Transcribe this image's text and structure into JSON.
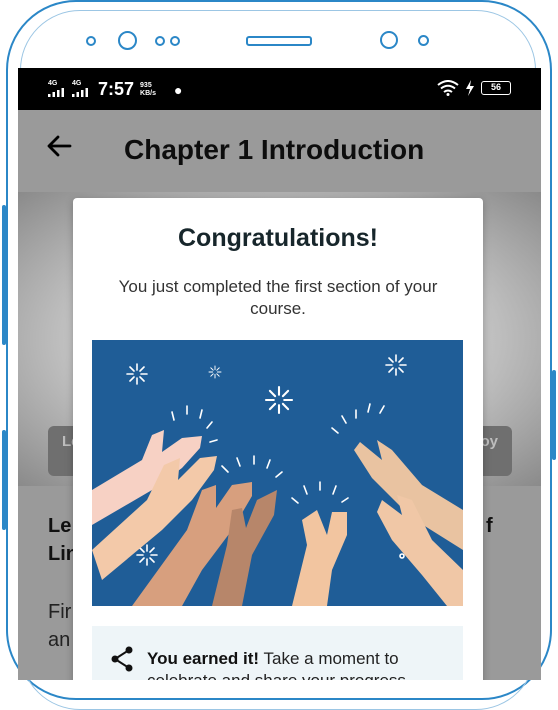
{
  "status_bar": {
    "signal_1": "4G",
    "signal_2": "4G",
    "time": "7:57",
    "speed_value": "935",
    "speed_unit": "KB/s",
    "battery": "56"
  },
  "app_bar": {
    "back_icon": "arrow-left",
    "title": "Chapter 1 Introduction"
  },
  "background": {
    "chip_left": "Le",
    "chip_right": "oy",
    "heading_line1": "Le",
    "heading_line2": "Lin",
    "heading_right": "f",
    "para_line1": "Fir",
    "para_line2": "an"
  },
  "modal": {
    "title": "Congratulations!",
    "subtitle": "You just completed the first section of your course.",
    "illustration": "clapping-hands-illustration",
    "card": {
      "icon": "share-icon",
      "bold": "You earned it!",
      "text": " Take a moment to celebrate and share your progress"
    }
  },
  "colors": {
    "device_outline": "#2b87c7",
    "overlay": "#9a9a9a",
    "illustration_bg": "#1f5d97",
    "card_bg": "#eef5f8"
  }
}
